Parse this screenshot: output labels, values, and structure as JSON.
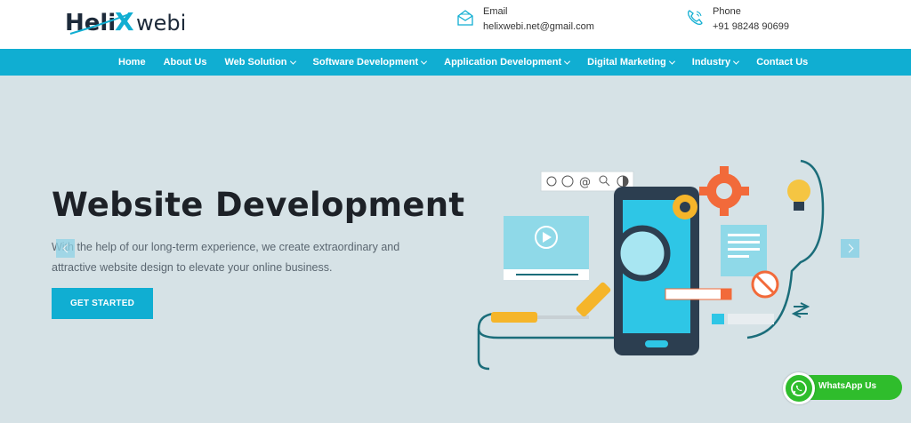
{
  "brand": {
    "logo_part1": "Heli",
    "logo_x": "X",
    "logo_part2": "webi",
    "color_dark": "#1d2a3a",
    "color_accent": "#10aed2"
  },
  "contact": {
    "email": {
      "label": "Email",
      "value": "helixwebi.net@gmail.com",
      "icon": "email-icon"
    },
    "phone": {
      "label": "Phone",
      "value": "+91 98248 90699",
      "icon": "phone-icon"
    }
  },
  "nav": {
    "items": [
      {
        "label": "Home",
        "dropdown": false
      },
      {
        "label": "About Us",
        "dropdown": false
      },
      {
        "label": "Web Solution",
        "dropdown": true
      },
      {
        "label": "Software Development",
        "dropdown": true
      },
      {
        "label": "Application Development",
        "dropdown": true
      },
      {
        "label": "Digital Marketing",
        "dropdown": true
      },
      {
        "label": "Industry",
        "dropdown": true
      },
      {
        "label": "Contact Us",
        "dropdown": false
      }
    ],
    "background": "#10aed2"
  },
  "hero": {
    "title": "Website Development",
    "description": "With the help of our long-term experience, we create extraordinary and attractive website design to elevate your online business.",
    "cta_label": "GET STARTED",
    "background": "#d6e2e6"
  },
  "whatsapp": {
    "label": "WhatsApp Us",
    "color": "#2fbd2c"
  }
}
